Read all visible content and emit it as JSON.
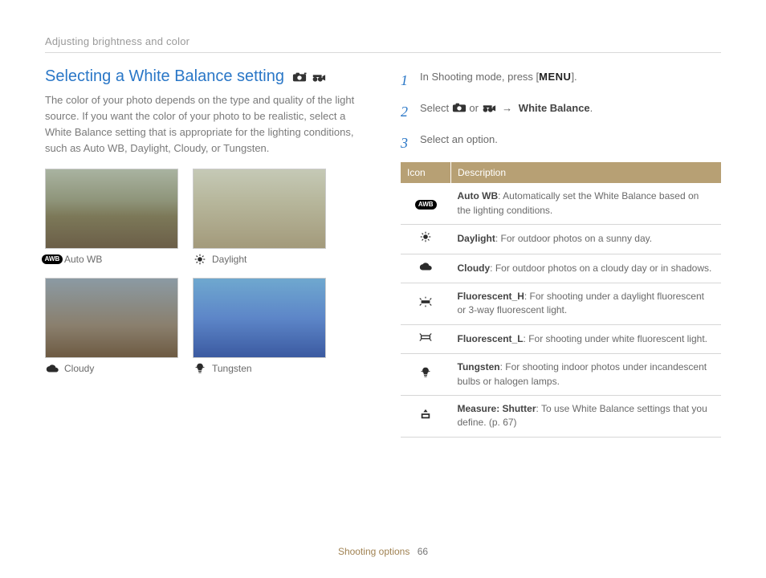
{
  "breadcrumb": "Adjusting brightness and color",
  "heading": "Selecting a White Balance setting",
  "intro": "The color of your photo depends on the type and quality of the light source. If you want the color of your photo to be realistic, select a White Balance setting that is appropriate for the lighting conditions, such as Auto WB, Daylight, Cloudy, or Tungsten.",
  "samples": [
    {
      "label": "Auto WB",
      "icon": "auto"
    },
    {
      "label": "Daylight",
      "icon": "sun"
    },
    {
      "label": "Cloudy",
      "icon": "cloud"
    },
    {
      "label": "Tungsten",
      "icon": "bulb"
    }
  ],
  "step1_a": "In Shooting mode, press [",
  "step1_menu": "MENU",
  "step1_b": "].",
  "step2_a": "Select ",
  "step2_or": " or ",
  "step2_arrow": " → ",
  "step2_target": "White Balance",
  "step2_end": ".",
  "step3": "Select an option.",
  "table": {
    "headers": [
      "Icon",
      "Description"
    ],
    "rows": [
      {
        "icon": "auto",
        "bold": "Auto WB",
        "rest": ": Automatically set the White Balance based on the lighting conditions."
      },
      {
        "icon": "sun",
        "bold": "Daylight",
        "rest": ": For outdoor photos on a sunny day."
      },
      {
        "icon": "cloud",
        "bold": "Cloudy",
        "rest": ": For outdoor photos on a cloudy day or in shadows."
      },
      {
        "icon": "fluoH",
        "bold": "Fluorescent_H",
        "rest": ": For shooting under a daylight fluorescent or 3-way fluorescent light."
      },
      {
        "icon": "fluoL",
        "bold": "Fluorescent_L",
        "rest": ": For shooting under white fluorescent light."
      },
      {
        "icon": "bulb",
        "bold": "Tungsten",
        "rest": ": For shooting indoor photos under incandescent bulbs or halogen lamps."
      },
      {
        "icon": "measure",
        "bold": "Measure: Shutter",
        "rest": ": To use White Balance settings that you define. (p. 67)"
      }
    ]
  },
  "footer_section": "Shooting options",
  "footer_page": "66"
}
